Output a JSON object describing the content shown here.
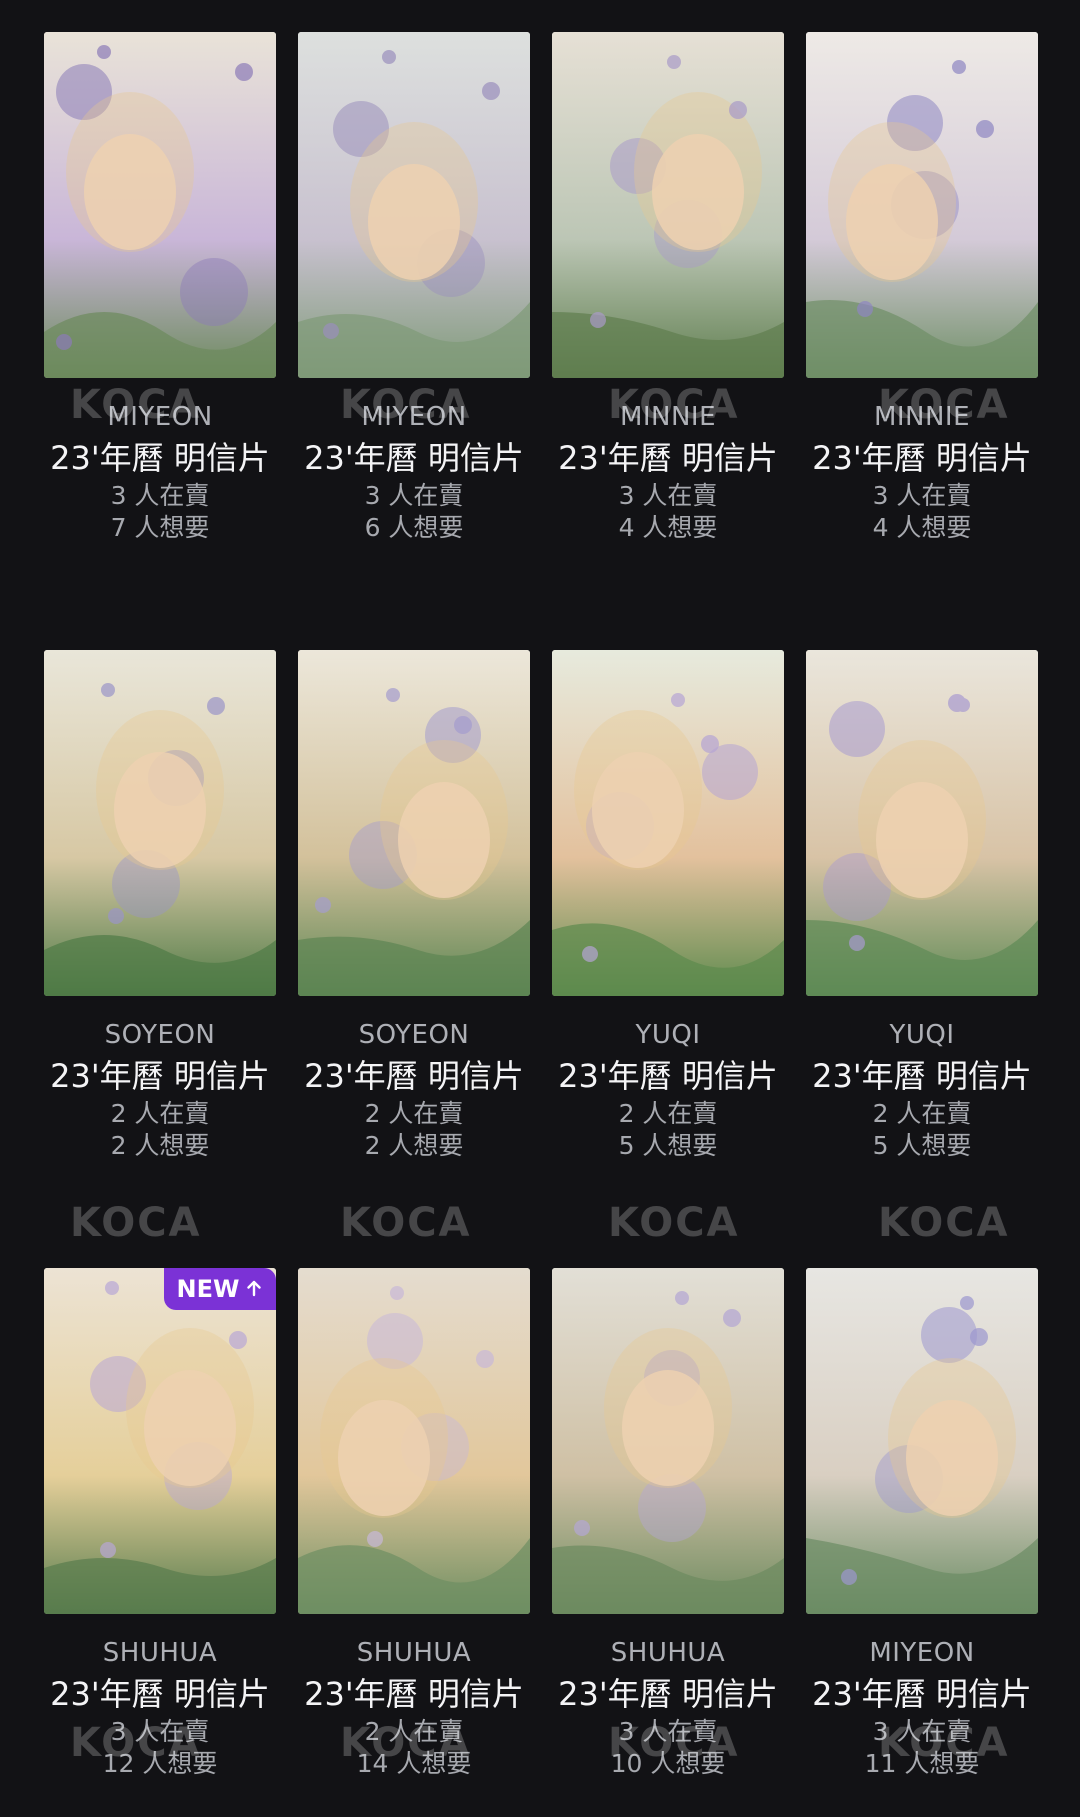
{
  "watermark": "KOCA",
  "badge": {
    "label": "NEW",
    "icon": "arrow-up-icon"
  },
  "cards": [
    {
      "member": "MIYEON",
      "title": "23'年曆 明信片",
      "selling": "3 人在賣",
      "wanting": "7 人想要",
      "is_new": false
    },
    {
      "member": "MIYEON",
      "title": "23'年曆 明信片",
      "selling": "3 人在賣",
      "wanting": "6 人想要",
      "is_new": false
    },
    {
      "member": "MINNIE",
      "title": "23'年曆 明信片",
      "selling": "3 人在賣",
      "wanting": "4 人想要",
      "is_new": false
    },
    {
      "member": "MINNIE",
      "title": "23'年曆 明信片",
      "selling": "3 人在賣",
      "wanting": "4 人想要",
      "is_new": false
    },
    {
      "member": "SOYEON",
      "title": "23'年曆 明信片",
      "selling": "2 人在賣",
      "wanting": "2 人想要",
      "is_new": false
    },
    {
      "member": "SOYEON",
      "title": "23'年曆 明信片",
      "selling": "2 人在賣",
      "wanting": "2 人想要",
      "is_new": false
    },
    {
      "member": "YUQI",
      "title": "23'年曆 明信片",
      "selling": "2 人在賣",
      "wanting": "5 人想要",
      "is_new": false
    },
    {
      "member": "YUQI",
      "title": "23'年曆 明信片",
      "selling": "2 人在賣",
      "wanting": "5 人想要",
      "is_new": false
    },
    {
      "member": "SHUHUA",
      "title": "23'年曆 明信片",
      "selling": "3 人在賣",
      "wanting": "12 人想要",
      "is_new": true
    },
    {
      "member": "SHUHUA",
      "title": "23'年曆 明信片",
      "selling": "2 人在賣",
      "wanting": "14 人想要",
      "is_new": false
    },
    {
      "member": "SHUHUA",
      "title": "23'年曆 明信片",
      "selling": "3 人在賣",
      "wanting": "10 人想要",
      "is_new": false
    },
    {
      "member": "MIYEON",
      "title": "23'年曆 明信片",
      "selling": "3 人在賣",
      "wanting": "11 人想要",
      "is_new": false
    }
  ],
  "colors": {
    "background": "#121215",
    "badge": "#7b32d6",
    "title": "#f4f4f6",
    "subtle": "#a7a9af"
  }
}
